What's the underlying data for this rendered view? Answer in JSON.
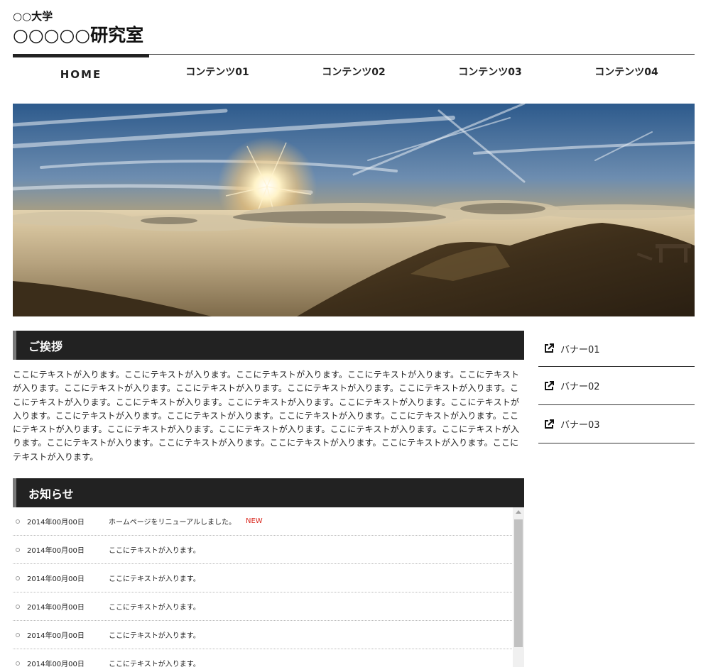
{
  "header": {
    "university": "○○大学",
    "lab_name": "○○○○○研究室"
  },
  "nav": {
    "items": [
      {
        "label": "HOME"
      },
      {
        "label": "コンテンツ01"
      },
      {
        "label": "コンテンツ02"
      },
      {
        "label": "コンテンツ03"
      },
      {
        "label": "コンテンツ04"
      }
    ]
  },
  "greeting": {
    "heading": "ご挨拶",
    "body": "ここにテキストが入ります。ここにテキストが入ります。ここにテキストが入ります。ここにテキストが入ります。ここにテキストが入ります。ここにテキストが入ります。ここにテキストが入ります。ここにテキストが入ります。ここにテキストが入ります。ここにテキストが入ります。ここにテキストが入ります。ここにテキストが入ります。ここにテキストが入ります。ここにテキストが入ります。ここにテキストが入ります。ここにテキストが入ります。ここにテキストが入ります。ここにテキストが入ります。ここにテキストが入ります。ここにテキストが入ります。ここにテキストが入ります。ここにテキストが入ります。ここにテキストが入ります。ここにテキストが入ります。ここにテキストが入ります。ここにテキストが入ります。ここにテキストが入ります。ここにテキストが入ります。"
  },
  "news": {
    "heading": "お知らせ",
    "items": [
      {
        "date": "2014年00月00日",
        "text": "ホームページをリニューアルしました。",
        "badge": "NEW"
      },
      {
        "date": "2014年00月00日",
        "text": "ここにテキストが入ります。",
        "badge": ""
      },
      {
        "date": "2014年00月00日",
        "text": "ここにテキストが入ります。",
        "badge": ""
      },
      {
        "date": "2014年00月00日",
        "text": "ここにテキストが入ります。",
        "badge": ""
      },
      {
        "date": "2014年00月00日",
        "text": "ここにテキストが入ります。",
        "badge": ""
      },
      {
        "date": "2014年00月00日",
        "text": "ここにテキストが入ります。",
        "badge": ""
      }
    ]
  },
  "sidebar": {
    "banners": [
      {
        "label": "バナー01",
        "icon": "external-link-icon"
      },
      {
        "label": "バナー02",
        "icon": "external-link-icon"
      },
      {
        "label": "バナー03",
        "icon": "external-link-icon"
      }
    ]
  },
  "colors": {
    "heading_bg": "#222222",
    "heading_accent": "#7a7a7a",
    "new_badge": "#d9261c"
  }
}
